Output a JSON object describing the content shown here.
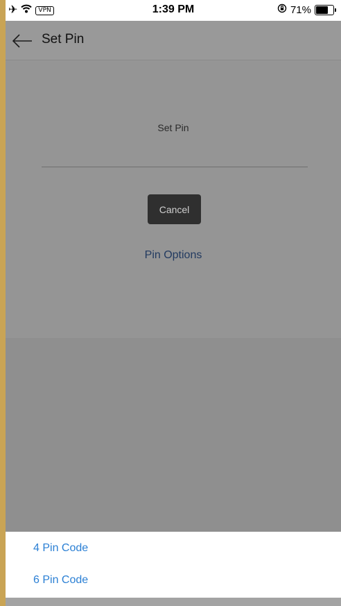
{
  "status_bar": {
    "airplane_icon": "airplane-icon",
    "wifi_icon": "wifi-icon",
    "vpn_label": "VPN",
    "time": "1:39 PM",
    "lock_icon": "orientation-lock-icon",
    "battery_percent_label": "71%",
    "battery_level": 0.71
  },
  "app_bar": {
    "back_icon": "back-arrow-icon",
    "title": "Set Pin"
  },
  "main": {
    "pin_label": "Set Pin",
    "cancel_label": "Cancel",
    "pin_options_label": "Pin Options"
  },
  "bottom_sheet": {
    "options": [
      {
        "label": "4 Pin Code"
      },
      {
        "label": "6 Pin Code"
      }
    ]
  },
  "colors": {
    "link": "#2a7fd4",
    "overlay": "#8f8f8f",
    "button_dark": "#2f2f2f",
    "border_gold": "#c9a455"
  }
}
